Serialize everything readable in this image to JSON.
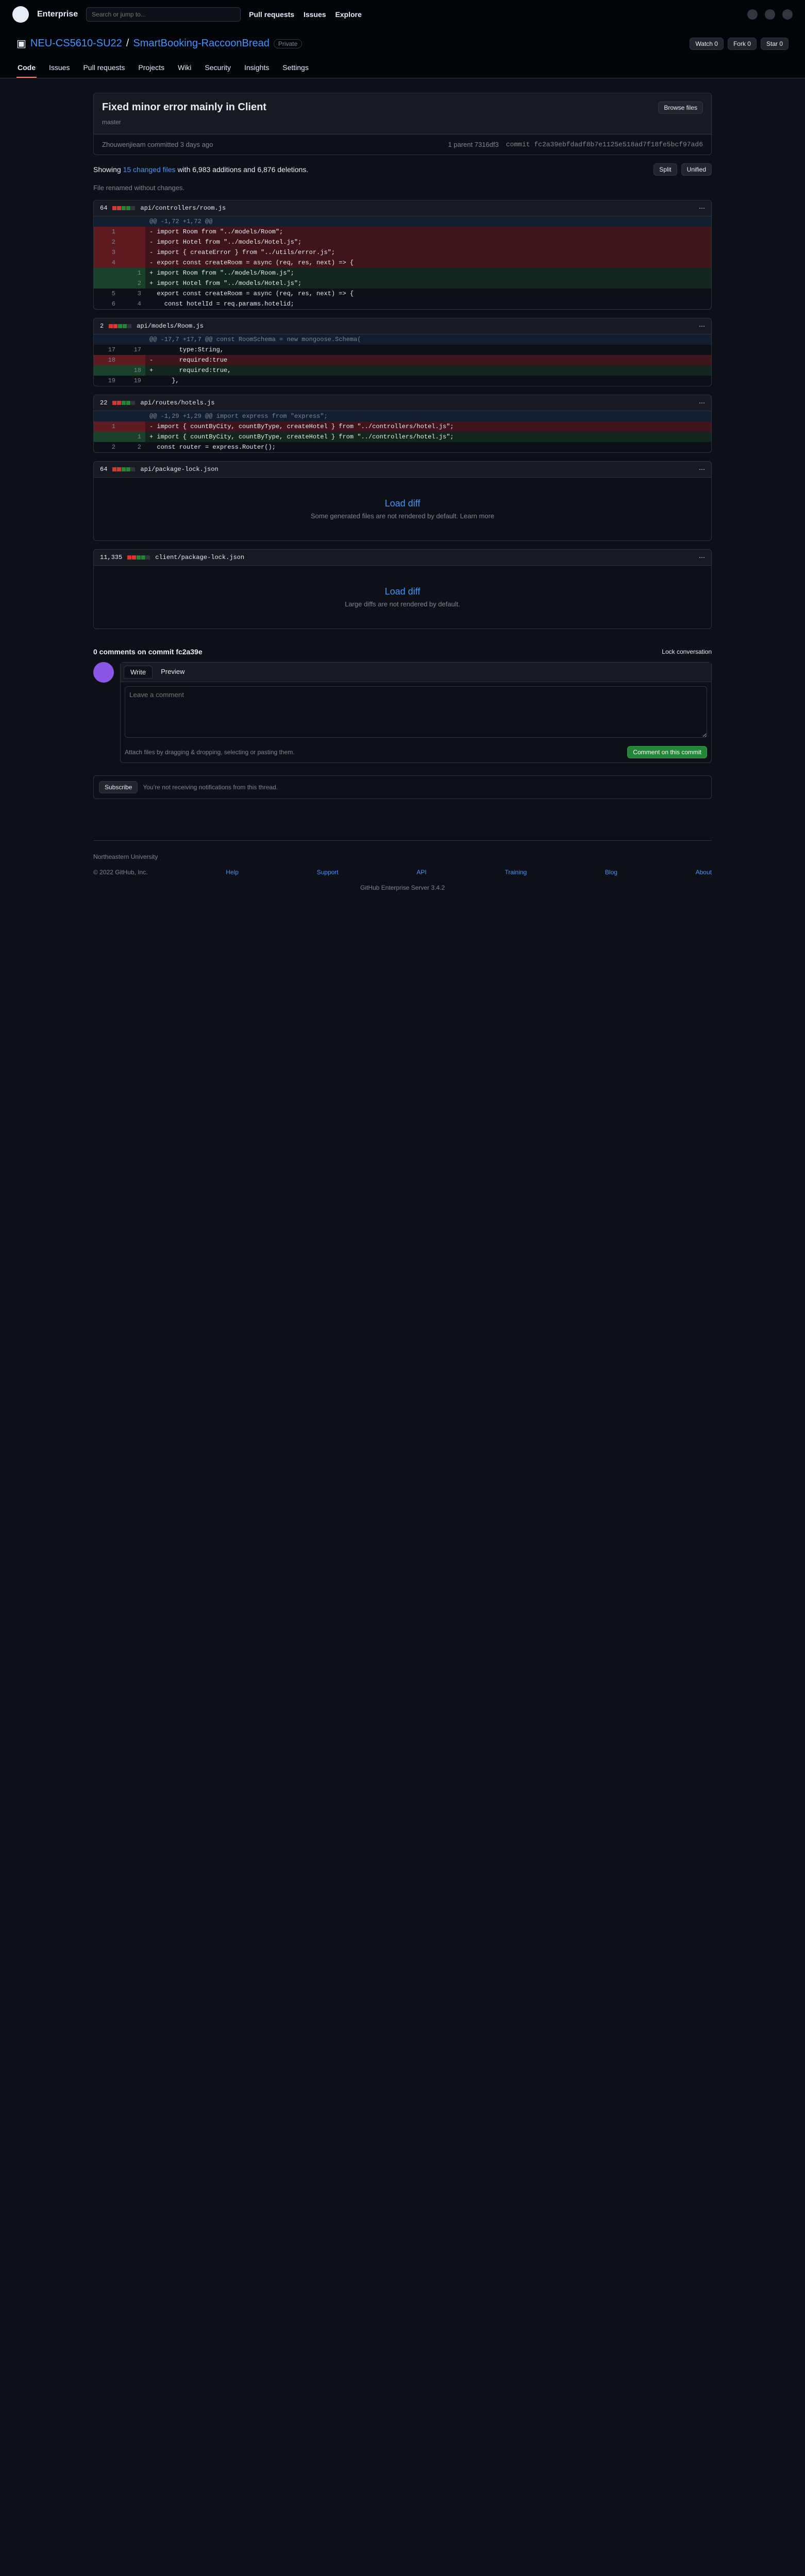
{
  "topbar": {
    "brand": "Enterprise",
    "search_placeholder": "Search or jump to...",
    "nav": [
      "Pull requests",
      "Issues",
      "Explore"
    ]
  },
  "repo": {
    "owner": "NEU-CS5610-SU22",
    "name": "SmartBooking-RaccoonBread",
    "visibility": "Private",
    "watch": "Watch 0",
    "fork": "Fork 0",
    "star": "Star 0"
  },
  "tabs": [
    "Code",
    "Issues",
    "Pull requests",
    "Projects",
    "Wiki",
    "Security",
    "Insights",
    "Settings"
  ],
  "commit": {
    "title": "Fixed minor error mainly in Client",
    "browse_label": "Browse files",
    "branch": "master",
    "author": "Zhouwenjieam committed 3 days ago",
    "parent": "1 parent 7316df3",
    "sha": "commit fc2a39ebfdadf8b7e1125e518ad7f18fe5bcf97ad6"
  },
  "stats": {
    "prefix": "Showing",
    "changed": "15 changed files",
    "suffix": "with 6,983 additions and 6,876 deletions.",
    "split": "Split",
    "unified": "Unified"
  },
  "note": "File renamed without changes.",
  "files": [
    {
      "count": "64",
      "path": "api/controllers/room.js",
      "lines": [
        {
          "t": "hunk",
          "a": "",
          "b": "",
          "c": "@@ -1,72 +1,72 @@"
        },
        {
          "t": "del",
          "a": "1",
          "b": "",
          "c": "- import Room from \"../models/Room\";"
        },
        {
          "t": "del",
          "a": "2",
          "b": "",
          "c": "- import Hotel from \"../models/Hotel.js\";"
        },
        {
          "t": "del",
          "a": "3",
          "b": "",
          "c": "- import { createError } from \"../utils/error.js\";"
        },
        {
          "t": "del",
          "a": "4",
          "b": "",
          "c": "- export const createRoom = async (req, res, next) => {"
        },
        {
          "t": "add",
          "a": "",
          "b": "1",
          "c": "+ import Room from \"../models/Room.js\";"
        },
        {
          "t": "add",
          "a": "",
          "b": "2",
          "c": "+ import Hotel from \"../models/Hotel.js\";"
        },
        {
          "t": "ctx",
          "a": "5",
          "b": "3",
          "c": "  export const createRoom = async (req, res, next) => {"
        },
        {
          "t": "ctx",
          "a": "6",
          "b": "4",
          "c": "    const hotelId = req.params.hotelid;"
        }
      ]
    },
    {
      "count": "2",
      "path": "api/models/Room.js",
      "lines": [
        {
          "t": "hunk",
          "a": "",
          "b": "",
          "c": "@@ -17,7 +17,7 @@ const RoomSchema = new mongoose.Schema("
        },
        {
          "t": "ctx",
          "a": "17",
          "b": "17",
          "c": "        type:String,"
        },
        {
          "t": "del",
          "a": "18",
          "b": "",
          "c": "-       required:true"
        },
        {
          "t": "add",
          "a": "",
          "b": "18",
          "c": "+       required:true,"
        },
        {
          "t": "ctx",
          "a": "19",
          "b": "19",
          "c": "      },"
        }
      ]
    },
    {
      "count": "22",
      "path": "api/routes/hotels.js",
      "lines": [
        {
          "t": "hunk",
          "a": "",
          "b": "",
          "c": "@@ -1,29 +1,29 @@ import express from \"express\";"
        },
        {
          "t": "del",
          "a": "1",
          "b": "",
          "c": "- import { countByCity, countByType, createHotel } from \"../controllers/hotel.js\";"
        },
        {
          "t": "add",
          "a": "",
          "b": "1",
          "c": "+ import { countByCity, countByType, createHotel } from \"../controllers/hotel.js\";"
        },
        {
          "t": "ctx",
          "a": "2",
          "b": "2",
          "c": "  const router = express.Router();"
        }
      ]
    }
  ],
  "load_diffs": [
    {
      "count": "64",
      "path": "api/package-lock.json",
      "title": "Load diff",
      "sub": "Some generated files are not rendered by default. Learn more"
    },
    {
      "count": "11,335",
      "path": "client/package-lock.json",
      "title": "Load diff",
      "sub": "Large diffs are not rendered by default."
    }
  ],
  "comments": {
    "title": "0 comments on commit fc2a39e",
    "lock": "Lock conversation",
    "write": "Write",
    "preview": "Preview",
    "placeholder": "Leave a comment",
    "attach": "Attach files by dragging & dropping, selecting or pasting them.",
    "submit": "Comment on this commit"
  },
  "subscribe": {
    "button": "Subscribe",
    "text": "You’re not receiving notifications from this thread."
  },
  "footer": {
    "org": "Northeastern University",
    "copyright": "© 2022 GitHub, Inc.",
    "links": [
      "Help",
      "Support",
      "API",
      "Training",
      "Blog",
      "About"
    ],
    "version": "GitHub Enterprise Server 3.4.2"
  },
  "colors": {
    "accent": "#4493f8",
    "del": "#3f151b",
    "add": "#12261e",
    "green": "#238636"
  }
}
